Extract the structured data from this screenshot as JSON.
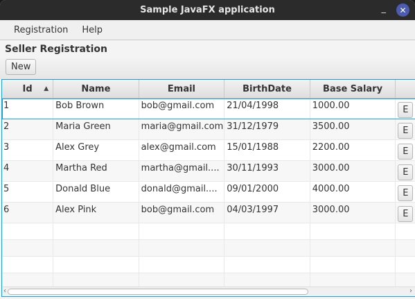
{
  "window": {
    "title": "Sample JavaFX application",
    "minimize": "_",
    "close": "✕"
  },
  "menu": [
    "Registration",
    "Help"
  ],
  "heading": "Seller Registration",
  "toolbar": {
    "new_label": "New"
  },
  "table": {
    "columns": [
      "Id",
      "Name",
      "Email",
      "BirthDate",
      "Base Salary",
      ""
    ],
    "sort_indicator": "▲",
    "rows": [
      [
        "1",
        "Bob Brown",
        "bob@gmail.com",
        "21/04/1998",
        "1000.00",
        "E"
      ],
      [
        "2",
        "Maria Green",
        "maria@gmail.com",
        "31/12/1979",
        "3500.00",
        "E"
      ],
      [
        "3",
        "Alex Grey",
        "alex@gmail.com",
        "15/01/1988",
        "2200.00",
        "E"
      ],
      [
        "4",
        "Martha Red",
        "martha@gmail....",
        "30/11/1993",
        "3000.00",
        "E"
      ],
      [
        "5",
        "Donald Blue",
        "donald@gmail....",
        "09/01/2000",
        "4000.00",
        "E"
      ],
      [
        "6",
        "Alex Pink",
        "bob@gmail.com",
        "04/03/1997",
        "3000.00",
        "E"
      ]
    ]
  },
  "scrollbar": {
    "left": "‹",
    "right": "›"
  }
}
